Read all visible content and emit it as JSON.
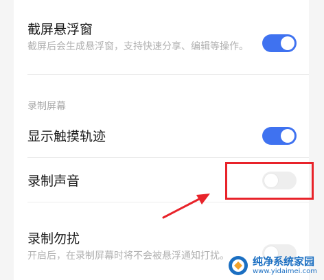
{
  "settings": {
    "screenshot_float": {
      "title": "截屏悬浮窗",
      "desc": "截屏后会生成悬浮窗，支持快速分享、编辑等操作。",
      "enabled": true
    },
    "section_record_label": "录制屏幕",
    "show_touch": {
      "title": "显示触摸轨迹",
      "enabled": true
    },
    "record_sound": {
      "title": "录制声音",
      "enabled": false
    },
    "record_dnd": {
      "title": "录制勿扰",
      "desc": "开启后，在录制屏幕时将不会被悬浮通知打扰。",
      "enabled": false
    }
  },
  "colors": {
    "toggle_on": "#3f72f0",
    "toggle_off": "#eeeeee",
    "highlight": "#e8232a"
  },
  "watermark": {
    "main": "纯净系统家园",
    "sub": "www.yidaimei.com"
  }
}
